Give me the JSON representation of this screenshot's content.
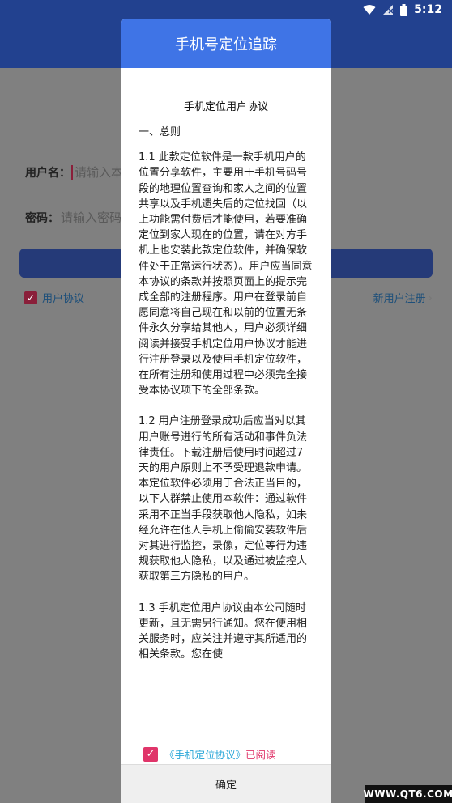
{
  "status_bar": {
    "time": "5:12",
    "icons": [
      "wifi-icon",
      "signal-icon",
      "battery-icon"
    ]
  },
  "login": {
    "username_label": "用户名：",
    "username_placeholder": "请输入本",
    "password_label": "密码：",
    "password_placeholder": "请输入密码",
    "agreement_label": "用户协议",
    "register_label": "新用户注册",
    "register_chevron": "›"
  },
  "dialog": {
    "header": "手机号定位追踪",
    "title": "手机定位用户协议",
    "section_heading": "一、总则",
    "paragraphs": [
      "1.1 此款定位软件是一款手机用户的位置分享软件，主要用于手机号码号段的地理位置查询和家人之间的位置共享以及手机遗失后的定位找回（以上功能需付费后才能使用，若要准确定位到家人现在的位置，请在对方手机上也安装此款定位软件，并确保软件处于正常运行状态）。用户应当同意本协议的条款并按照页面上的提示完成全部的注册程序。用户在登录前自愿同意将自己现在和以前的位置无条件永久分享给其他人，用户必须详细阅读并接受手机定位用户协议才能进行注册登录以及使用手机定位软件，在所有注册和使用过程中必须完全接受本协议项下的全部条款。",
      "1.2 用户注册登录成功后应当对以其用户账号进行的所有活动和事件负法律责任。下载注册后使用时间超过7天的用户原则上不予受理退款申请。本定位软件必须用于合法正当目的，以下人群禁止使用本软件：通过软件采用不正当手段获取他人隐私，如未经允许在他人手机上偷偷安装软件后对其进行监控，录像，定位等行为违规获取他人隐私，以及通过被监控人获取第三方隐私的用户。",
      "1.3 手机定位用户协议由本公司随时更新，且无需另行通知。您在使用相关服务时，应关注并遵守其所适用的相关条款。您在使"
    ],
    "read_link": "《手机定位协议》",
    "read_tail": "已阅读",
    "confirm": "确定"
  },
  "watermark": "WWW.QT6.COM",
  "colors": {
    "dialog_header": "#3f74e6",
    "appbar": "#22418f",
    "checkbox": "#e0356a",
    "link": "#2aa7d8"
  }
}
